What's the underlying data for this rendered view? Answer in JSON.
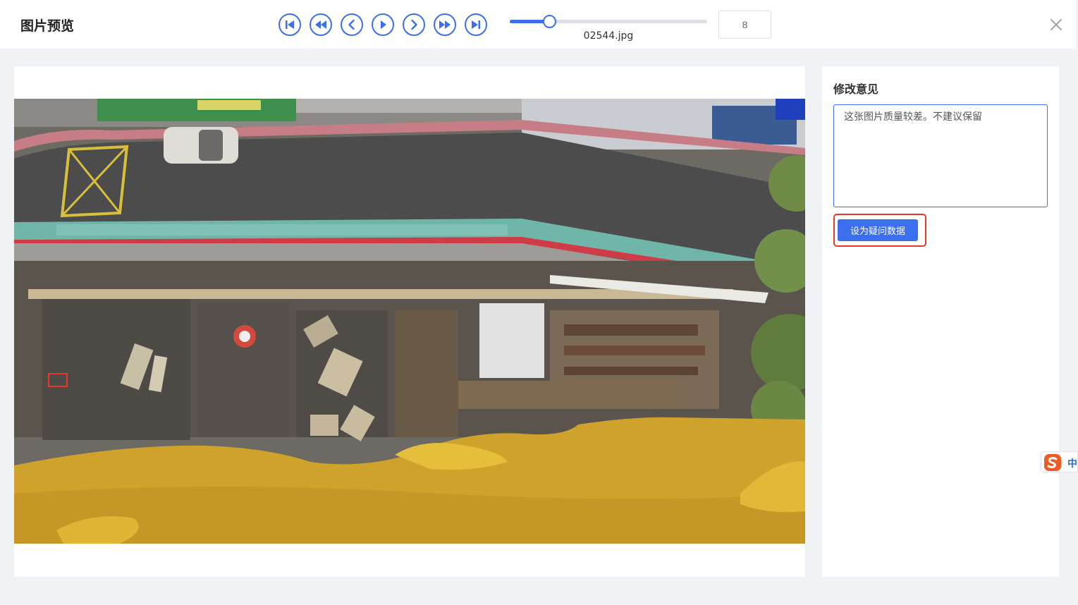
{
  "header": {
    "title": "图片预览",
    "controls": [
      {
        "name": "first-button",
        "icon": "skip-to-first-icon"
      },
      {
        "name": "rewind-button",
        "icon": "fast-backward-icon"
      },
      {
        "name": "previous-button",
        "icon": "chevron-left-icon"
      },
      {
        "name": "play-button",
        "icon": "play-icon"
      },
      {
        "name": "next-button",
        "icon": "chevron-right-icon"
      },
      {
        "name": "fast-forward-button",
        "icon": "fast-forward-icon"
      },
      {
        "name": "last-button",
        "icon": "skip-to-last-icon"
      }
    ],
    "slider_position": 0.2,
    "filename": "02544.jpg",
    "page_value": "8",
    "close_icon": "close-icon"
  },
  "side_panel": {
    "title": "修改意见",
    "comment": "这张图片质量较差。不建议保留",
    "suspect_button_label": "设为疑问数据"
  },
  "ime": {
    "label": "中",
    "icon": "sogou-s-icon"
  },
  "colors": {
    "accent": "#3b6ff0",
    "highlight": "#e53a2a",
    "background": "#f0f2f5"
  }
}
